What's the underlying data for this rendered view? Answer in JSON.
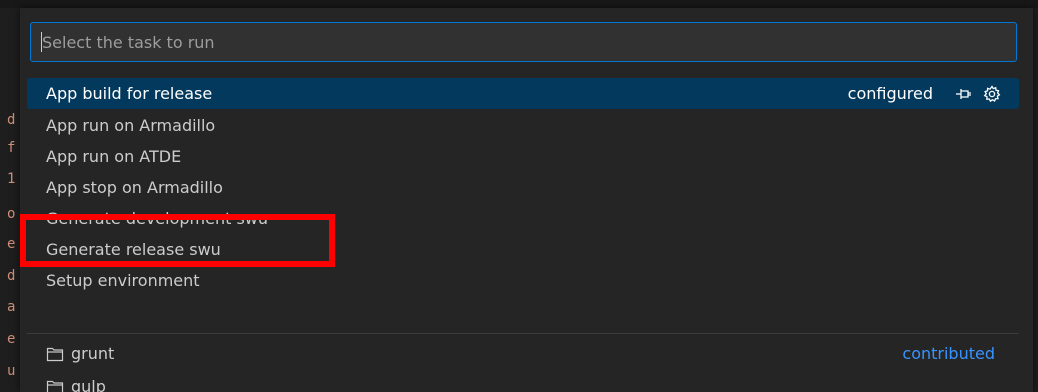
{
  "quick_pick": {
    "placeholder": "Select the task to run",
    "items": [
      {
        "label": "App build for release",
        "description": "configured",
        "selected": true,
        "icons": [
          "pin-icon",
          "gear-icon"
        ]
      },
      {
        "label": "App run on Armadillo"
      },
      {
        "label": "App run on ATDE"
      },
      {
        "label": "App stop on Armadillo"
      },
      {
        "label": "Generate development swu",
        "highlighted": true
      },
      {
        "label": "Generate release swu"
      },
      {
        "label": "Setup environment"
      }
    ],
    "groups": [
      {
        "label": "grunt",
        "description": "contributed",
        "icon": "folder-icon"
      },
      {
        "label": "gulp",
        "icon": "folder-icon"
      }
    ]
  },
  "background_editor": {
    "chars": [
      "d",
      "f",
      "1",
      "o",
      "e",
      "d",
      "a",
      "e",
      "u"
    ]
  },
  "colors": {
    "accent": "#0078d4",
    "selection": "#04395e",
    "highlight": "#ff0000",
    "contributed": "#3794ff"
  }
}
